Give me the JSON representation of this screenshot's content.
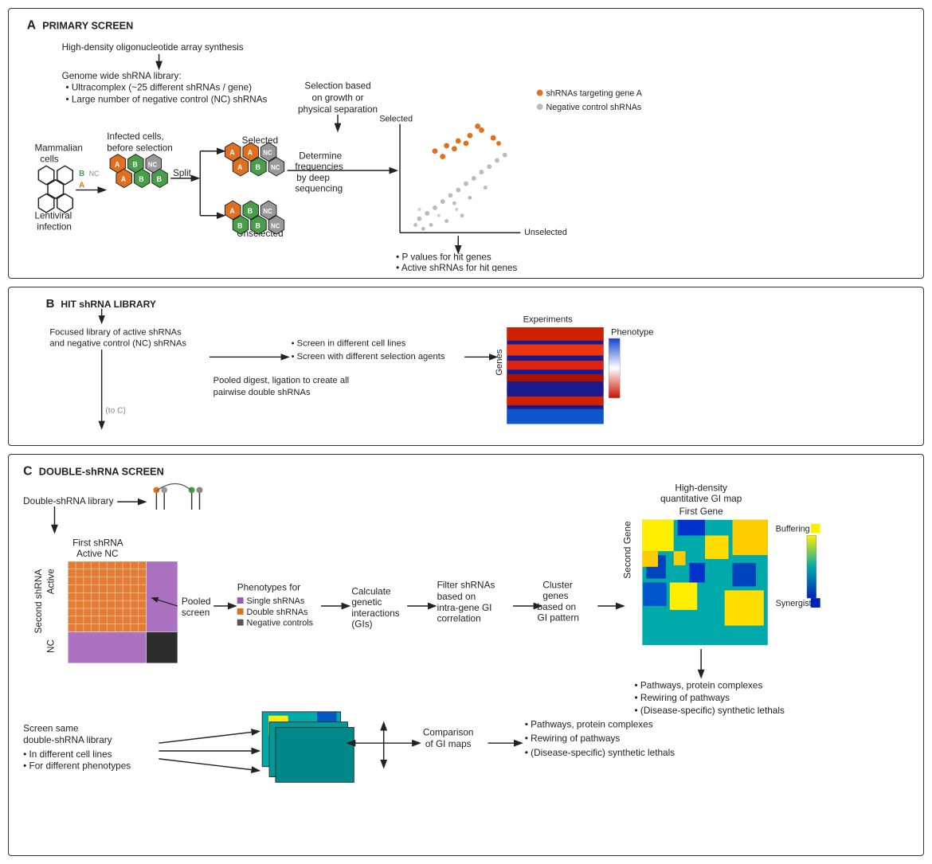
{
  "sections": {
    "a": {
      "letter": "A",
      "title": "PRIMARY SCREEN",
      "content": {
        "step1": "High-density oligonucleotide array synthesis",
        "step2_title": "Genome wide shRNA library:",
        "step2_bullets": [
          "Ultracomplex (~25 different shRNAs / gene)",
          "Large number of negative control (NC) shRNAs"
        ],
        "mammalian_cells": "Mammalian cells",
        "lentiviral": "Lentiviral infection",
        "infected_cells": "Infected cells, before selection",
        "split": "Split",
        "selection": "Selection based on growth or physical separation",
        "selected": "Selected",
        "unselected": "Unselected",
        "determine": "Determine frequencies by deep sequencing",
        "legend1": "shRNAs targeting gene A",
        "legend2": "Negative control shRNAs",
        "outputs": [
          "P values for hit genes",
          "Active shRNAs for hit genes"
        ]
      }
    },
    "b": {
      "letter": "B",
      "title": "HIT shRNA LIBRARY",
      "content": {
        "focused": "Focused library of active shRNAs",
        "focused2": "and negative control (NC) shRNAs",
        "screen1": "Screen in different cell lines",
        "screen2": "Screen with different selection agents",
        "experiments": "Experiments",
        "genes": "Genes",
        "phenotype": "Phenotype",
        "pooled_digest": "Pooled digest, ligation to create all",
        "pairwise": "pairwise double shRNAs"
      }
    },
    "c": {
      "letter": "C",
      "title": "DOUBLE-shRNA SCREEN",
      "content": {
        "double_lib": "Double-shRNA library",
        "first_shrna": "First shRNA",
        "active": "Active",
        "nc": "NC",
        "second_shrna": "Second shRNA",
        "active2": "Active",
        "nc2": "NC",
        "pooled": "Pooled",
        "screen": "screen",
        "phenotypes_title": "Phenotypes for",
        "phenotypes": [
          "Single shRNAs",
          "Double shRNAs",
          "Negative controls"
        ],
        "calculate": "Calculate genetic interactions (GIs)",
        "filter_title": "Filter shRNAs",
        "filter_sub": "based on",
        "filter_sub2": "intra-gene GI",
        "filter_sub3": "correlation",
        "cluster_title": "Cluster genes",
        "cluster_sub": "based on",
        "cluster_sub2": "GI pattern",
        "gi_map": "High-density quantitative GI map",
        "first_gene": "First Gene",
        "second_gene": "Second Gene",
        "buffering": "Buffering",
        "synergistic": "Synergistic",
        "screen_same": "Screen same double-shRNA library",
        "different1": "In different cell lines",
        "different2": "For different phenotypes",
        "comparison": "Comparison of GI maps",
        "outputs": [
          "Pathways, protein complexes",
          "Rewiring of pathways",
          "(Disease-specific) synthetic lethals"
        ]
      }
    }
  }
}
